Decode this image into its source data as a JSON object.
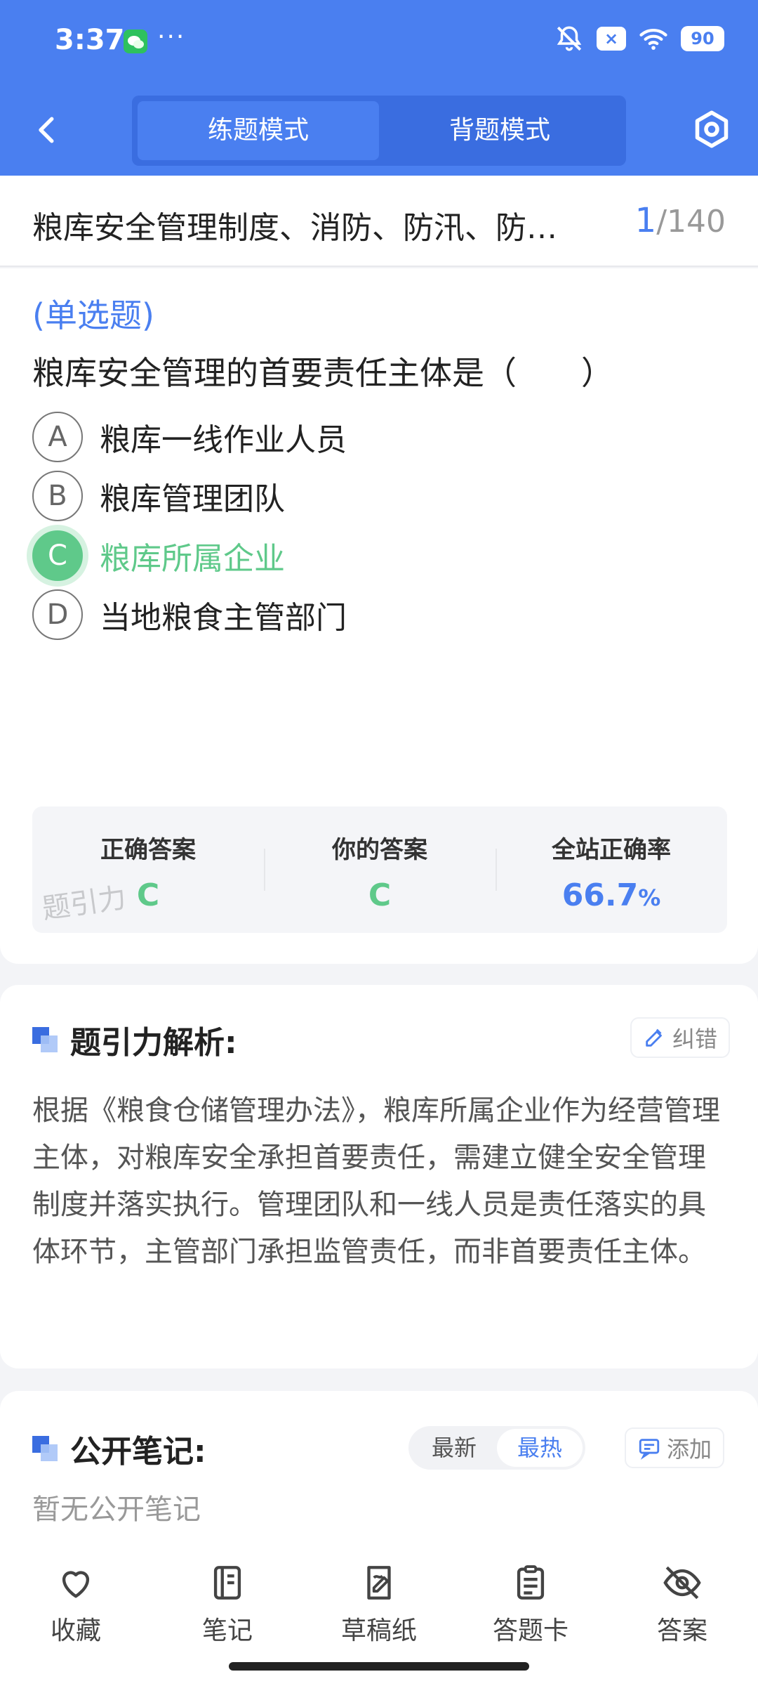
{
  "status_bar": {
    "time": "3:37",
    "more": "···",
    "battery": "90",
    "x_badge": "×"
  },
  "nav": {
    "tabs": [
      "练题模式",
      "背题模式"
    ],
    "active_tab": 0
  },
  "question_header": {
    "title": "粮库安全管理制度、消防、防汛、防…",
    "current": "1",
    "total": "/140"
  },
  "question": {
    "type": "(单选题)",
    "text": "粮库安全管理的首要责任主体是（　　）",
    "options": [
      {
        "letter": "A",
        "text": "粮库一线作业人员"
      },
      {
        "letter": "B",
        "text": "粮库管理团队"
      },
      {
        "letter": "C",
        "text": "粮库所属企业"
      },
      {
        "letter": "D",
        "text": "当地粮食主管部门"
      }
    ]
  },
  "answer_summary": {
    "correct_label": "正确答案",
    "correct_value": "C",
    "yours_label": "你的答案",
    "yours_value": "C",
    "rate_label": "全站正确率",
    "rate_value": "66.7",
    "rate_unit": "%",
    "watermark": "题引力"
  },
  "analysis": {
    "title": "题引力解析:",
    "report_label": "纠错",
    "text": "根据《粮食仓储管理办法》，粮库所属企业作为经营管理主体，对粮库安全承担首要责任，需建立健全安全管理制度并落实执行。管理团队和一线人员是责任落实的具体环节，主管部门承担监管责任，而非首要责任主体。"
  },
  "notes": {
    "title": "公开笔记:",
    "sort_options": [
      "最新",
      "最热"
    ],
    "add_label": "添加",
    "empty_text": "暂无公开笔记"
  },
  "bottom_bar": [
    {
      "label": "收藏",
      "icon": "heart-icon"
    },
    {
      "label": "笔记",
      "icon": "notebook-icon"
    },
    {
      "label": "草稿纸",
      "icon": "draft-icon"
    },
    {
      "label": "答题卡",
      "icon": "answer-card-icon"
    },
    {
      "label": "答案",
      "icon": "eye-off-icon"
    }
  ],
  "colors": {
    "primary": "#4a7ff0",
    "correct": "#5fc98a"
  }
}
